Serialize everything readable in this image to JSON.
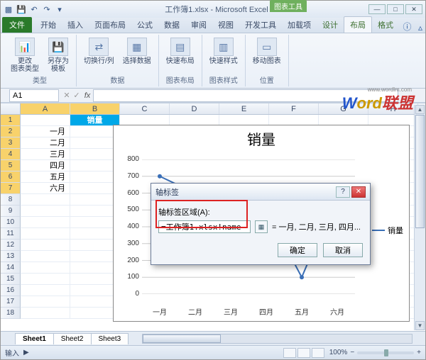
{
  "title": "工作簿1.xlsx - Microsoft Excel",
  "contextual_tab_group": "图表工具",
  "tabs": {
    "file": "文件",
    "items": [
      "开始",
      "插入",
      "页面布局",
      "公式",
      "数据",
      "审阅",
      "视图",
      "开发工具",
      "加载项",
      "设计",
      "布局",
      "格式"
    ],
    "active_index": 10
  },
  "ribbon": {
    "groups": [
      {
        "label": "类型",
        "buttons": [
          {
            "label": "更改\n图表类型",
            "ico": "📊"
          },
          {
            "label": "另存为\n模板",
            "ico": "💾"
          }
        ]
      },
      {
        "label": "数据",
        "buttons": [
          {
            "label": "切换行/列",
            "ico": "⇄"
          },
          {
            "label": "选择数据",
            "ico": "▦"
          }
        ]
      },
      {
        "label": "图表布局",
        "buttons": [
          {
            "label": "快速布局",
            "ico": "▤"
          }
        ]
      },
      {
        "label": "图表样式",
        "buttons": [
          {
            "label": "快速样式",
            "ico": "▥"
          }
        ]
      },
      {
        "label": "位置",
        "buttons": [
          {
            "label": "移动图表",
            "ico": "▭"
          }
        ]
      }
    ]
  },
  "namebox": "A1",
  "columns": [
    "A",
    "B",
    "C",
    "D",
    "E",
    "F",
    "G",
    "H"
  ],
  "row_count": 18,
  "data_a": [
    "",
    "一月",
    "二月",
    "三月",
    "四月",
    "五月",
    "六月"
  ],
  "b_header": "销量",
  "chart_data": {
    "type": "line",
    "title": "销量",
    "categories": [
      "一月",
      "二月",
      "三月",
      "四月",
      "五月",
      "六月"
    ],
    "series": [
      {
        "name": "销量",
        "values": [
          700,
          600,
          200,
          500,
          100,
          600
        ]
      }
    ],
    "ylim": [
      0,
      800
    ],
    "yticks": [
      0,
      100,
      200,
      300,
      400,
      500,
      600,
      700,
      800
    ],
    "xlabel": "",
    "ylabel": ""
  },
  "dialog": {
    "title": "轴标签",
    "label": "轴标签区域(A):",
    "value": "=工作簿1.xlsx!name",
    "preview": "= 一月, 二月, 三月, 四月...",
    "ok": "确定",
    "cancel": "取消"
  },
  "sheets": [
    "Sheet1",
    "Sheet2",
    "Sheet3"
  ],
  "status": {
    "mode": "输入",
    "zoom": "100%"
  },
  "watermark": {
    "a": "W",
    "b": "ord",
    "c": "联盟",
    "url": "www.wordlm.com"
  }
}
